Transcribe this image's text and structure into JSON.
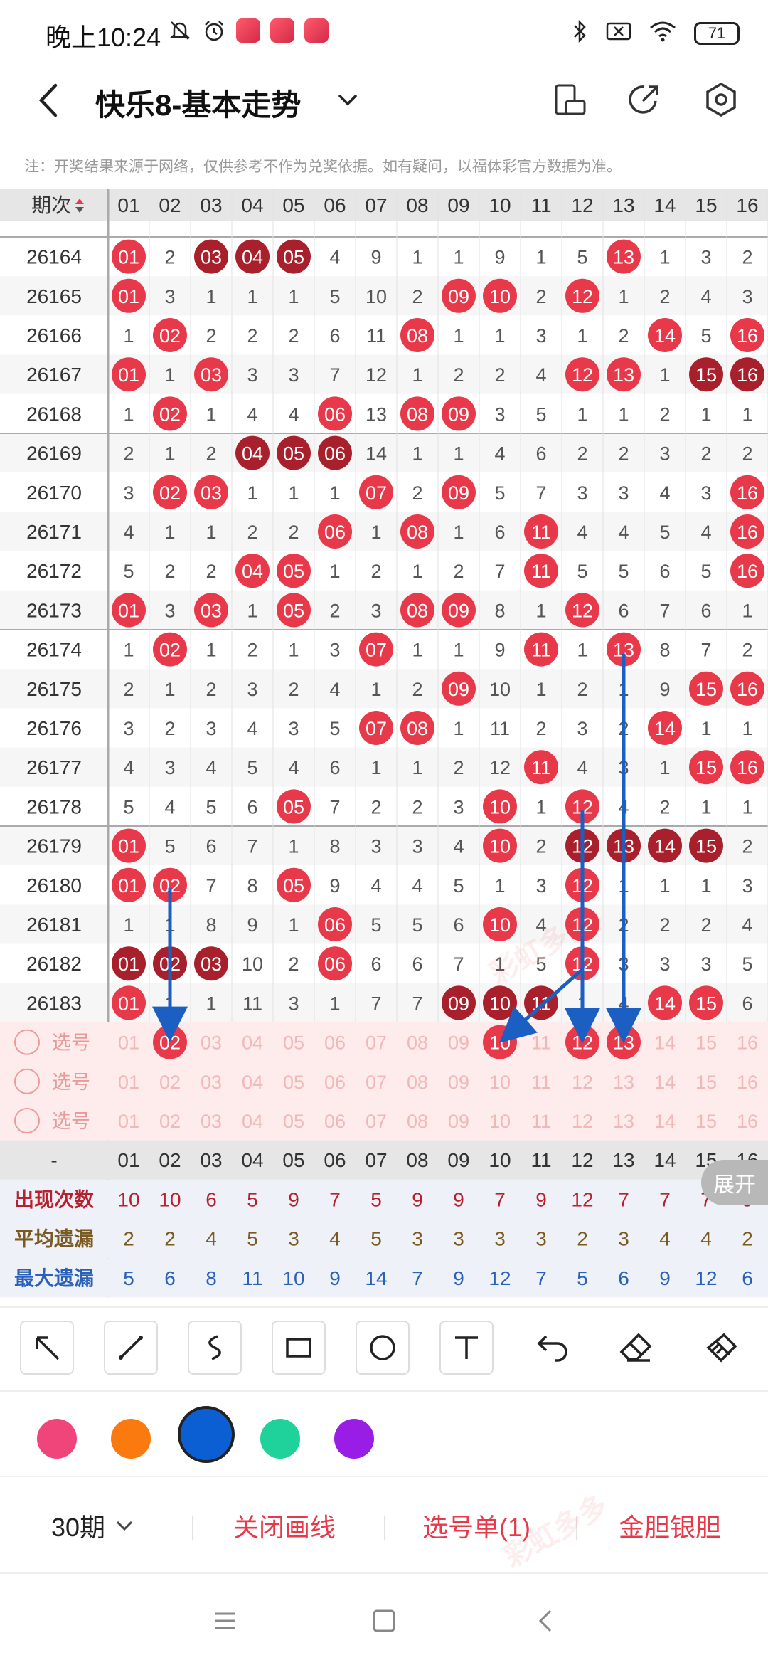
{
  "status": {
    "time": "晚上10:24",
    "battery": "71"
  },
  "header": {
    "title": "快乐8-基本走势"
  },
  "notice": "注：开奖结果来源于网络，仅供参考不作为兑奖依据。如有疑问，以福体彩官方数据为准。",
  "table": {
    "corner_label": "期次",
    "columns": [
      "01",
      "02",
      "03",
      "04",
      "05",
      "06",
      "07",
      "08",
      "09",
      "10",
      "11",
      "12",
      "13",
      "14",
      "15",
      "16"
    ],
    "rows": [
      {
        "period": "26164",
        "cells": [
          "01",
          "2",
          "03",
          "04",
          "05",
          "4",
          "9",
          "1",
          "1",
          "9",
          "1",
          "5",
          "13",
          "1",
          "3",
          "2"
        ]
      },
      {
        "period": "26165",
        "cells": [
          "01",
          "3",
          "1",
          "1",
          "1",
          "5",
          "10",
          "2",
          "09",
          "10",
          "2",
          "12",
          "1",
          "2",
          "4",
          "3"
        ]
      },
      {
        "period": "26166",
        "cells": [
          "1",
          "02",
          "2",
          "2",
          "2",
          "6",
          "11",
          "08",
          "1",
          "1",
          "3",
          "1",
          "2",
          "14",
          "5",
          "16"
        ]
      },
      {
        "period": "26167",
        "cells": [
          "01",
          "1",
          "03",
          "3",
          "3",
          "7",
          "12",
          "1",
          "2",
          "2",
          "4",
          "12",
          "13",
          "1",
          "15",
          "16"
        ]
      },
      {
        "period": "26168",
        "cells": [
          "1",
          "02",
          "1",
          "4",
          "4",
          "06",
          "13",
          "08",
          "09",
          "3",
          "5",
          "1",
          "1",
          "2",
          "1",
          "1"
        ]
      },
      {
        "period": "26169",
        "cells": [
          "2",
          "1",
          "2",
          "04",
          "05",
          "06",
          "14",
          "1",
          "1",
          "4",
          "6",
          "2",
          "2",
          "3",
          "2",
          "2"
        ]
      },
      {
        "period": "26170",
        "cells": [
          "3",
          "02",
          "03",
          "1",
          "1",
          "1",
          "07",
          "2",
          "09",
          "5",
          "7",
          "3",
          "3",
          "4",
          "3",
          "16"
        ]
      },
      {
        "period": "26171",
        "cells": [
          "4",
          "1",
          "1",
          "2",
          "2",
          "06",
          "1",
          "08",
          "1",
          "6",
          "11",
          "4",
          "4",
          "5",
          "4",
          "16"
        ]
      },
      {
        "period": "26172",
        "cells": [
          "5",
          "2",
          "2",
          "04",
          "05",
          "1",
          "2",
          "1",
          "2",
          "7",
          "11",
          "5",
          "5",
          "6",
          "5",
          "16"
        ]
      },
      {
        "period": "26173",
        "cells": [
          "01",
          "3",
          "03",
          "1",
          "05",
          "2",
          "3",
          "08",
          "09",
          "8",
          "1",
          "12",
          "6",
          "7",
          "6",
          "1"
        ]
      },
      {
        "period": "26174",
        "cells": [
          "1",
          "02",
          "1",
          "2",
          "1",
          "3",
          "07",
          "1",
          "1",
          "9",
          "11",
          "1",
          "13",
          "8",
          "7",
          "2"
        ]
      },
      {
        "period": "26175",
        "cells": [
          "2",
          "1",
          "2",
          "3",
          "2",
          "4",
          "1",
          "2",
          "09",
          "10",
          "1",
          "2",
          "1",
          "9",
          "15",
          "16"
        ]
      },
      {
        "period": "26176",
        "cells": [
          "3",
          "2",
          "3",
          "4",
          "3",
          "5",
          "07",
          "08",
          "1",
          "11",
          "2",
          "3",
          "2",
          "14",
          "1",
          "1"
        ]
      },
      {
        "period": "26177",
        "cells": [
          "4",
          "3",
          "4",
          "5",
          "4",
          "6",
          "1",
          "1",
          "2",
          "12",
          "11",
          "4",
          "3",
          "1",
          "15",
          "16"
        ]
      },
      {
        "period": "26178",
        "cells": [
          "5",
          "4",
          "5",
          "6",
          "05",
          "7",
          "2",
          "2",
          "3",
          "10",
          "1",
          "12",
          "4",
          "2",
          "1",
          "1"
        ]
      },
      {
        "period": "26179",
        "cells": [
          "01",
          "5",
          "6",
          "7",
          "1",
          "8",
          "3",
          "3",
          "4",
          "10",
          "2",
          "12",
          "13",
          "14",
          "15",
          "2"
        ]
      },
      {
        "period": "26180",
        "cells": [
          "01",
          "02",
          "7",
          "8",
          "05",
          "9",
          "4",
          "4",
          "5",
          "1",
          "3",
          "12",
          "1",
          "1",
          "1",
          "3"
        ]
      },
      {
        "period": "26181",
        "cells": [
          "1",
          "1",
          "8",
          "9",
          "1",
          "06",
          "5",
          "5",
          "6",
          "10",
          "4",
          "12",
          "2",
          "2",
          "2",
          "4"
        ]
      },
      {
        "period": "26182",
        "cells": [
          "01",
          "02",
          "03",
          "10",
          "2",
          "06",
          "6",
          "6",
          "7",
          "1",
          "5",
          "12",
          "3",
          "3",
          "3",
          "5"
        ]
      },
      {
        "period": "26183",
        "cells": [
          "01",
          "1",
          "1",
          "11",
          "3",
          "1",
          "7",
          "7",
          "09",
          "10",
          "11",
          "1",
          "4",
          "14",
          "15",
          "6"
        ]
      }
    ],
    "hits": [
      [
        1,
        3,
        4,
        5,
        13
      ],
      [
        1,
        9,
        10,
        12
      ],
      [
        2,
        8,
        14,
        16
      ],
      [
        1,
        3,
        12,
        13,
        15,
        16
      ],
      [
        2,
        6,
        8,
        9
      ],
      [
        4,
        5,
        6
      ],
      [
        2,
        3,
        7,
        9,
        16
      ],
      [
        6,
        8,
        11,
        16
      ],
      [
        4,
        5,
        11,
        16
      ],
      [
        1,
        3,
        5,
        8,
        9,
        12
      ],
      [
        2,
        7,
        11,
        13
      ],
      [
        9,
        15,
        16
      ],
      [
        7,
        8,
        14
      ],
      [
        11,
        15,
        16
      ],
      [
        5,
        10,
        12
      ],
      [
        1,
        10,
        12,
        13,
        14,
        15
      ],
      [
        1,
        2,
        5,
        12
      ],
      [
        6,
        10,
        12
      ],
      [
        1,
        2,
        3,
        6,
        12
      ],
      [
        1,
        9,
        10,
        11,
        14,
        15
      ]
    ],
    "dark_hits": [
      [
        3,
        4,
        5
      ],
      [],
      [],
      [
        15,
        16
      ],
      [],
      [
        4,
        5,
        6
      ],
      [],
      [],
      [],
      [],
      [],
      [],
      [],
      [],
      [],
      [
        12,
        13,
        14,
        15
      ],
      [],
      [],
      [
        1,
        2,
        3
      ],
      [
        9,
        10,
        11
      ]
    ],
    "select_label": "选号",
    "selected": [
      2,
      10,
      12,
      13
    ],
    "stats_header_first": "-",
    "stats": [
      {
        "label": "出现次数",
        "values": [
          "10",
          "10",
          "6",
          "5",
          "9",
          "7",
          "5",
          "9",
          "9",
          "7",
          "9",
          "12",
          "7",
          "7",
          "7",
          "9"
        ],
        "color": "#b8202f"
      },
      {
        "label": "平均遗漏",
        "values": [
          "2",
          "2",
          "4",
          "5",
          "3",
          "4",
          "5",
          "3",
          "3",
          "3",
          "3",
          "2",
          "3",
          "4",
          "4",
          "2"
        ],
        "color": "#7a5a20"
      },
      {
        "label": "最大遗漏",
        "values": [
          "5",
          "6",
          "8",
          "11",
          "10",
          "9",
          "14",
          "7",
          "9",
          "12",
          "7",
          "5",
          "6",
          "9",
          "12",
          "6"
        ],
        "color": "#2b62b8"
      }
    ],
    "expand_label": "展开"
  },
  "colors": {
    "red": "#e8394a",
    "dark": "#a8202b",
    "arrow": "#1c5fc2"
  },
  "palette": [
    "#f0457a",
    "#fb7a10",
    "#0b5fd3",
    "#1fd19a",
    "#9a1de6"
  ],
  "bottom": {
    "period": "30期",
    "close": "关闭画线",
    "select": "选号单(1)",
    "gold": "金胆银胆"
  }
}
